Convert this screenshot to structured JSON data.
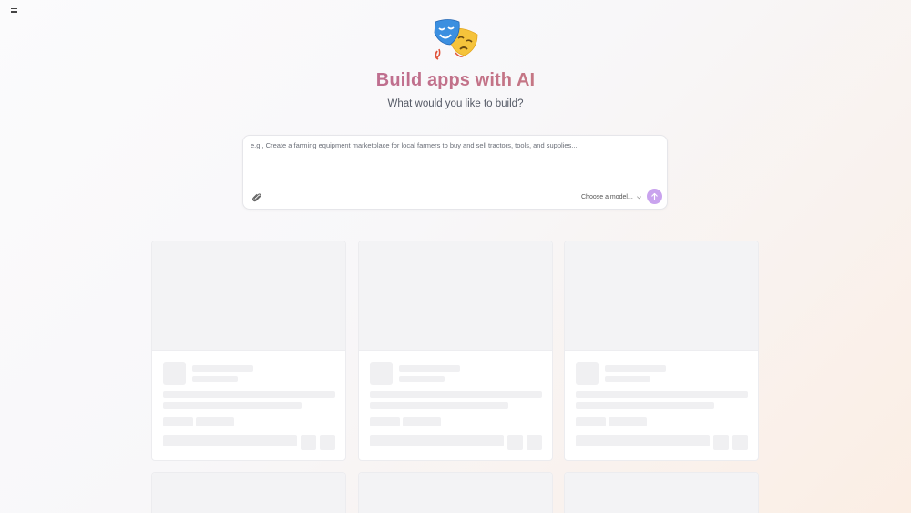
{
  "nav": {
    "menu_icon": "hamburger-menu-icon"
  },
  "hero": {
    "logo_icon": "performing-arts-masks-icon",
    "title": "Build apps with AI",
    "subtitle": "What would you like to build?"
  },
  "prompt": {
    "placeholder": "e.g., Create a farming equipment marketplace for local farmers to buy and sell tractors, tools, and supplies...",
    "value": "",
    "attach_icon": "paperclip-icon",
    "model_select_label": "Choose a model...",
    "model_chevron_icon": "chevron-down-icon",
    "send_icon": "arrow-up-icon"
  },
  "colors": {
    "title_gradient_start": "#b56aa6",
    "title_gradient_end": "#d48a6a",
    "send_button": "#c9a3ee"
  },
  "gallery": {
    "state": "loading",
    "placeholder_card_count": 6
  }
}
